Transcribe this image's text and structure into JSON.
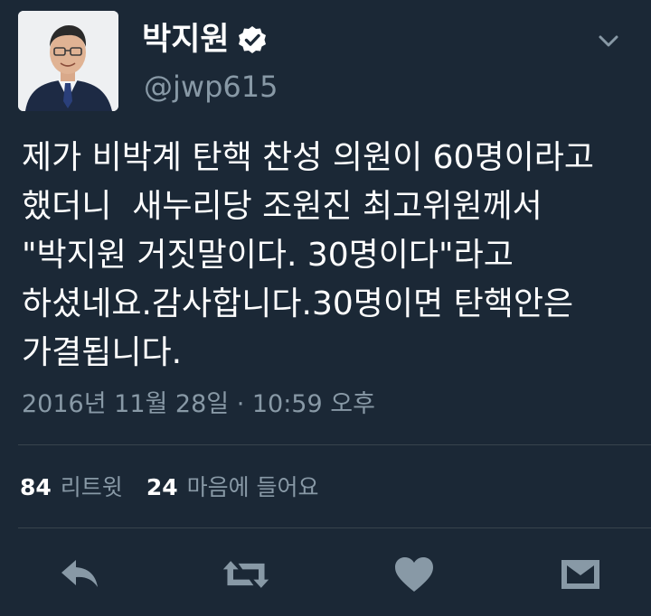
{
  "author": {
    "display_name": "박지원",
    "handle": "@jwp615",
    "verified_icon": "verified-badge-icon",
    "avatar_icon": "profile-photo"
  },
  "tweet": {
    "lines": [
      "제가 비박계 탄핵 찬성 의원이 60명이라고",
      "했더니  새누리당 조원진 최고위원께서",
      "\"박지원 거짓말이다. 30명이다\"라고",
      "하셨네요.감사합니다.30명이면 탄핵안은",
      "가결됩니다."
    ],
    "timestamp": "2016년 11월 28일 · 10:59 오후"
  },
  "stats": {
    "retweets": {
      "count": "84",
      "label": "리트윗"
    },
    "likes": {
      "count": "24",
      "label": "마음에 들어요"
    }
  },
  "actions": [
    {
      "name": "reply",
      "icon": "reply-icon"
    },
    {
      "name": "retweet",
      "icon": "retweet-icon"
    },
    {
      "name": "like",
      "icon": "heart-icon"
    },
    {
      "name": "direct-message",
      "icon": "envelope-icon"
    }
  ],
  "colors": {
    "background": "#1b2836",
    "primary_text": "#ffffff",
    "secondary_text": "#8899a6",
    "icon": "#8899a6",
    "divider": "#38444d"
  }
}
